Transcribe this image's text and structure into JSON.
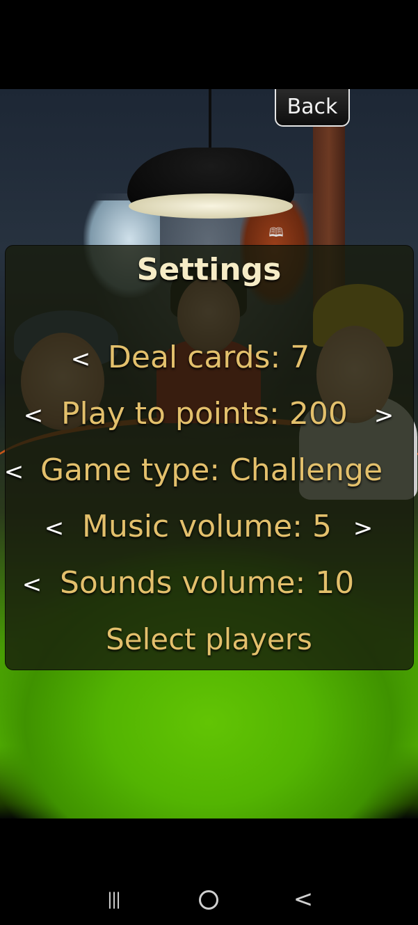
{
  "back_button": {
    "label": "Back"
  },
  "settings": {
    "title": "Settings",
    "rows": [
      {
        "label": "Deal cards: 7",
        "left_arrow": "<",
        "right_arrow": ""
      },
      {
        "label": "Play to points: 200",
        "left_arrow": "<",
        "right_arrow": ">"
      },
      {
        "label": "Game type: Challenge",
        "left_arrow": "<",
        "right_arrow": ""
      },
      {
        "label": "Music volume: 5",
        "left_arrow": "<",
        "right_arrow": ">"
      },
      {
        "label": "Sounds volume: 10",
        "left_arrow": "<",
        "right_arrow": ""
      }
    ],
    "select_players": "Select players"
  },
  "icons": {
    "book": "book-icon",
    "recent_apps": "recent-apps-icon",
    "home": "home-icon",
    "nav_back": "nav-back-icon"
  },
  "nav": {
    "recent": "|||",
    "back": "<"
  }
}
